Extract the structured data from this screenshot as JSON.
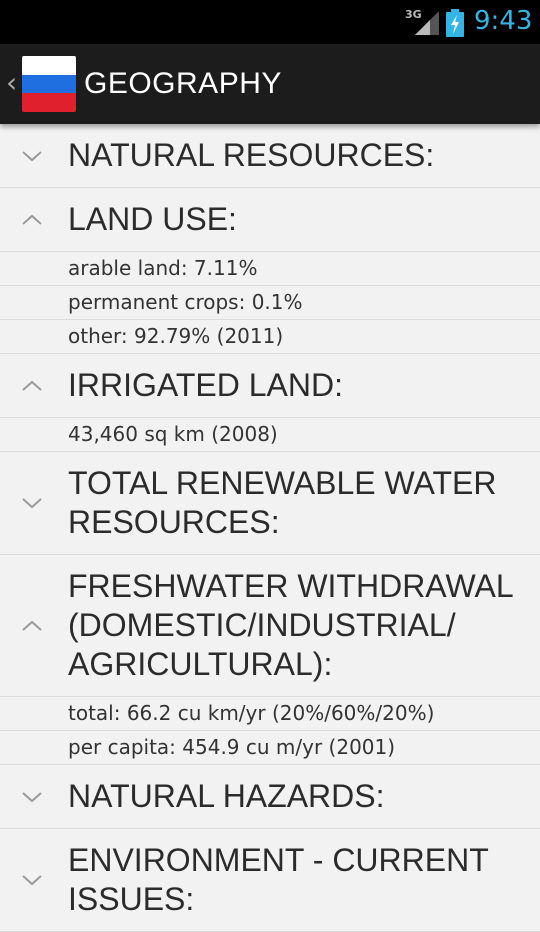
{
  "status_bar": {
    "network": "3G",
    "time": "9:43",
    "icons": [
      "signal-icon",
      "battery-charging-icon"
    ]
  },
  "action_bar": {
    "title": "GEOGRAPHY",
    "flag_colors": [
      "#ffffff",
      "#1f6fe0",
      "#e0202c"
    ]
  },
  "sections": [
    {
      "title": "NATURAL RESOURCES:",
      "expanded": false,
      "items": []
    },
    {
      "title": "LAND USE:",
      "expanded": true,
      "items": [
        "arable land: 7.11%",
        "permanent crops: 0.1%",
        "other: 92.79% (2011)"
      ]
    },
    {
      "title": "IRRIGATED LAND:",
      "expanded": true,
      "items": [
        "43,460 sq km (2008)"
      ]
    },
    {
      "title": "TOTAL RENEWABLE WATER RESOURCES:",
      "expanded": false,
      "items": []
    },
    {
      "title": "FRESHWATER WITHDRAWAL (DOMESTIC/INDUSTRIAL/ AGRICULTURAL):",
      "expanded": true,
      "items": [
        "total: 66.2 cu km/yr (20%/60%/20%)",
        "per capita: 454.9 cu m/yr (2001)"
      ]
    },
    {
      "title": "NATURAL HAZARDS:",
      "expanded": false,
      "items": []
    },
    {
      "title": "ENVIRONMENT - CURRENT ISSUES:",
      "expanded": false,
      "items": []
    }
  ]
}
